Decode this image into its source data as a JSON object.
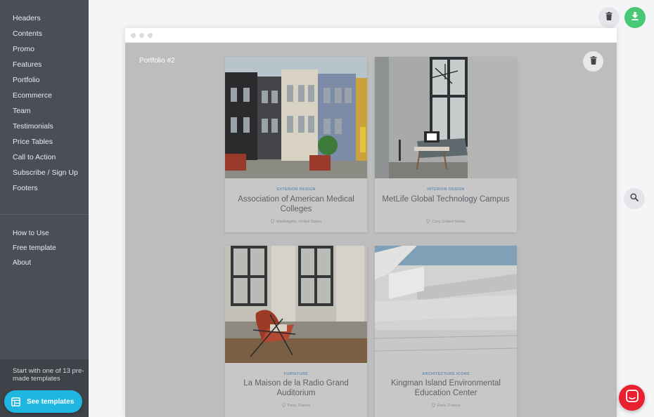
{
  "sidebar": {
    "items": [
      "Headers",
      "Contents",
      "Promo",
      "Features",
      "Portfolio",
      "Ecommerce",
      "Team",
      "Testimonials",
      "Price Tables",
      "Call to Action",
      "Subscribe / Sign Up",
      "Footers"
    ],
    "secondary": [
      "How to Use",
      "Free template",
      "About"
    ],
    "footer_text": "Start with one of 13 pre-made templates",
    "see_templates_label": "See templates"
  },
  "canvas": {
    "block_label": "Portfolio #2",
    "cards": [
      {
        "category": "Exterior Design",
        "title": "Association of American Medical Colleges",
        "location": "Washington, United States"
      },
      {
        "category": "Interior Design",
        "title": "MetLife Global Technology Campus",
        "location": "Cary, United States"
      },
      {
        "category": "Furniture",
        "title": "La Maison de la Radio Grand Auditorium",
        "location": "Paris, France"
      },
      {
        "category": "Architecture Icons",
        "title": "Kingman Island Environmental Education Center",
        "location": "Paris, France"
      }
    ]
  },
  "icons": {
    "trash": "trash-icon",
    "download": "download-icon",
    "zoom": "search-icon",
    "chat": "chat-icon",
    "templates": "template-grid-icon",
    "pin": "map-pin-icon"
  },
  "colors": {
    "sidebar": "#4b4e56",
    "accent": "#1fb7e1",
    "download": "#48c774",
    "chat": "#e8202f"
  }
}
